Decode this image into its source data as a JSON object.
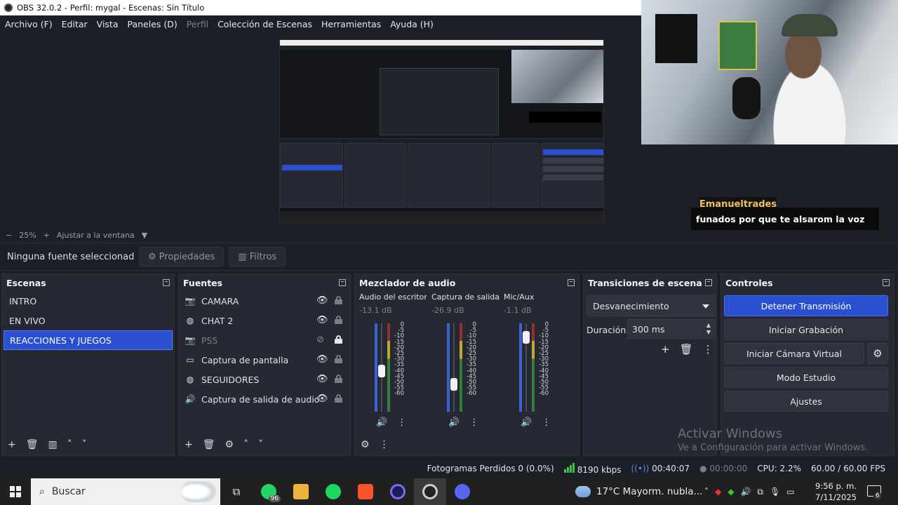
{
  "window": {
    "title": "OBS 32.0.2 - Perfil: mygal - Escenas: Sin Título"
  },
  "menu": [
    "Archivo (F)",
    "Editar",
    "Vista",
    "Paneles (D)",
    "Perfil",
    "Colección de Escenas",
    "Herramientas",
    "Ayuda (H)"
  ],
  "zoom": {
    "minus": "−",
    "value": "25%",
    "plus": "+",
    "fit": "Ajustar a la ventana"
  },
  "chat": {
    "user": "Emanueltrades",
    "message": "funados por que te alsarom la voz"
  },
  "source_bar": {
    "no_selection": "Ninguna fuente seleccionad",
    "properties": "Propiedades",
    "filters": "Filtros"
  },
  "docks": {
    "scenes": {
      "title": "Escenas",
      "items": [
        "INTRO",
        "EN VIVO",
        "REACCIONES Y JUEGOS"
      ],
      "active_index": 2
    },
    "sources": {
      "title": "Fuentes",
      "items": [
        {
          "label": "CAMARA",
          "icon": "camera-icon",
          "visible": true,
          "locked": false
        },
        {
          "label": "CHAT 2",
          "icon": "globe-icon",
          "visible": true,
          "locked": false
        },
        {
          "label": "PS5",
          "icon": "camera-icon",
          "visible": false,
          "locked": true
        },
        {
          "label": "Captura de pantalla",
          "icon": "monitor-icon",
          "visible": true,
          "locked": false
        },
        {
          "label": "SEGUIDORES",
          "icon": "globe-icon",
          "visible": true,
          "locked": false
        },
        {
          "label": "Captura de salida de audio",
          "icon": "speaker-icon",
          "visible": true,
          "locked": false
        }
      ]
    },
    "mixer": {
      "title": "Mezclador de audio",
      "channels": [
        {
          "name": "Audio del escritorio",
          "db": "-13.1 dB",
          "level": 0.45
        },
        {
          "name": "Captura de salida d",
          "db": "-26.9 dB",
          "level": 0.28
        },
        {
          "name": "Mic/Aux",
          "db": "-1.1 dB",
          "level": 0.9
        }
      ],
      "scale": [
        "0",
        "-5",
        "-10",
        "-15",
        "-20",
        "-25",
        "-30",
        "-35",
        "-40",
        "-45",
        "-50",
        "-55",
        "-60"
      ]
    },
    "transitions": {
      "title": "Transiciones de escena",
      "selected": "Desvanecimiento",
      "duration_label": "Duración",
      "duration_value": "300 ms"
    },
    "controls": {
      "title": "Controles",
      "stop_stream": "Detener Transmisión",
      "start_recording": "Iniciar Grabación",
      "virtual_cam": "Iniciar Cámara Virtual",
      "studio_mode": "Modo Estudio",
      "settings": "Ajustes"
    }
  },
  "watermark": {
    "line1": "Activar Windows",
    "line2": "Ve a Configuración para activar Windows."
  },
  "status": {
    "dropped": "Fotogramas Perdidos 0 (0.0%)",
    "bitrate": "8190 kbps",
    "stream_time": "00:40:07",
    "rec_time": "00:00:00",
    "cpu": "CPU: 2.2%",
    "fps": "60.00 / 60.00 FPS"
  },
  "taskbar": {
    "search_placeholder": "Buscar",
    "whatsapp_badge": "96",
    "weather": "17°C  Mayorm. nubla...",
    "time": "9:56 p. m.",
    "date": "7/11/2025",
    "notifications": "6"
  },
  "colors": {
    "accent": "#2a4fd1",
    "panel": "#262833",
    "bg": "#1d1f26"
  }
}
